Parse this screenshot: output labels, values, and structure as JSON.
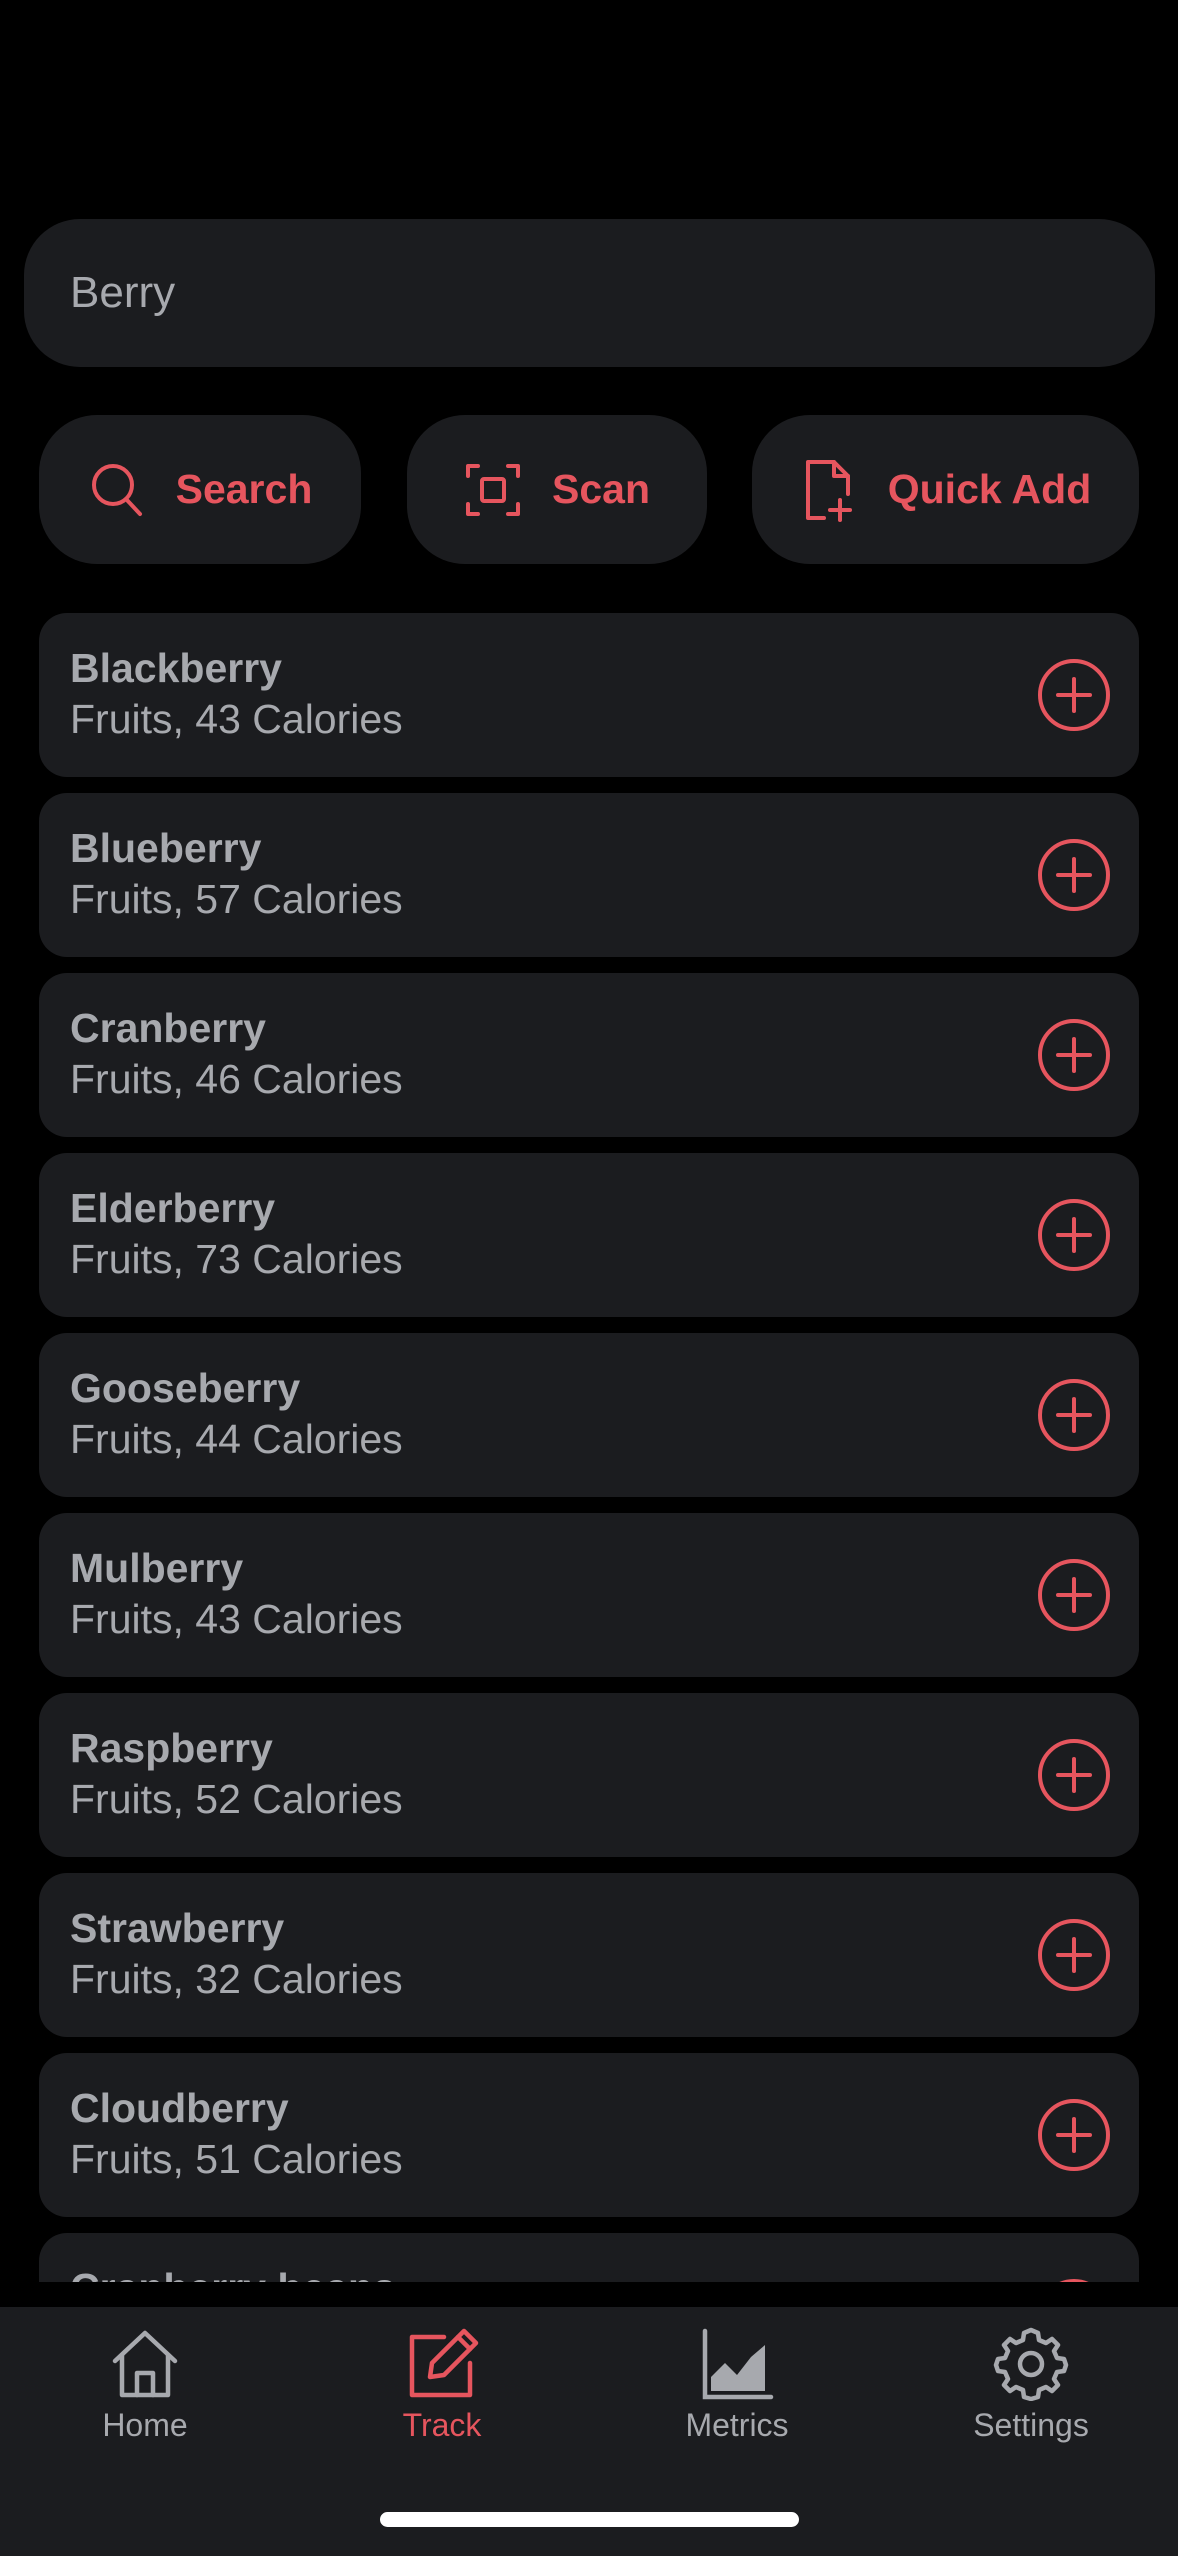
{
  "search": {
    "value": "Berry"
  },
  "actions": {
    "search_label": "Search",
    "scan_label": "Scan",
    "quick_add_label": "Quick Add"
  },
  "foods": [
    {
      "name": "Blackberry",
      "detail": "Fruits, 43 Calories"
    },
    {
      "name": "Blueberry",
      "detail": "Fruits, 57 Calories"
    },
    {
      "name": "Cranberry",
      "detail": "Fruits, 46 Calories"
    },
    {
      "name": "Elderberry",
      "detail": "Fruits, 73 Calories"
    },
    {
      "name": "Gooseberry",
      "detail": "Fruits, 44 Calories"
    },
    {
      "name": "Mulberry",
      "detail": "Fruits, 43 Calories"
    },
    {
      "name": "Raspberry",
      "detail": "Fruits, 52 Calories"
    },
    {
      "name": "Strawberry",
      "detail": "Fruits, 32 Calories"
    },
    {
      "name": "Cloudberry",
      "detail": "Fruits, 51 Calories"
    },
    {
      "name": "Cranberry beans",
      "detail": ""
    }
  ],
  "tabs": {
    "home": "Home",
    "track": "Track",
    "metrics": "Metrics",
    "settings": "Settings",
    "active": "track"
  },
  "colors": {
    "accent": "#e6555e",
    "background": "#000000",
    "surface": "#1b1c1f",
    "text": "#a7a9ae"
  },
  "icons": {
    "search": "search-icon",
    "scan": "scan-icon",
    "quick_add": "document-plus-icon",
    "add": "plus-circle-icon",
    "home": "home-icon",
    "track": "edit-icon",
    "metrics": "chart-icon",
    "settings": "gear-icon"
  }
}
